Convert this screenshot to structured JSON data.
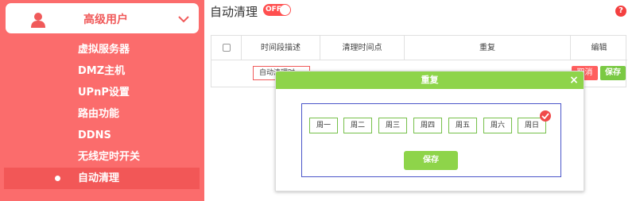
{
  "sidebar": {
    "section_title": "高级用户",
    "items": [
      {
        "label": "虚拟服务器"
      },
      {
        "label": "DMZ主机"
      },
      {
        "label": "UPnP设置"
      },
      {
        "label": "路由功能"
      },
      {
        "label": "DDNS"
      },
      {
        "label": "无线定时开关"
      },
      {
        "label": "自动清理"
      }
    ]
  },
  "header": {
    "title": "自动清理",
    "toggle_label": "OFF",
    "help_label": "?"
  },
  "table": {
    "columns": [
      "时间段描述",
      "清理时间点",
      "重复",
      "编辑"
    ],
    "row": {
      "description_value": "自动清理时",
      "cancel_label": "取消",
      "save_label": "保存"
    }
  },
  "modal": {
    "title": "重复",
    "close_label": "×",
    "days": [
      "周一",
      "周二",
      "周三",
      "周四",
      "周五",
      "周六",
      "周日"
    ],
    "selected_day": "周日",
    "save_label": "保存"
  },
  "colors": {
    "sidebar_bg": "#fb6c6c",
    "accent_red": "#f05a5a",
    "accent_green": "#8ed44a"
  }
}
